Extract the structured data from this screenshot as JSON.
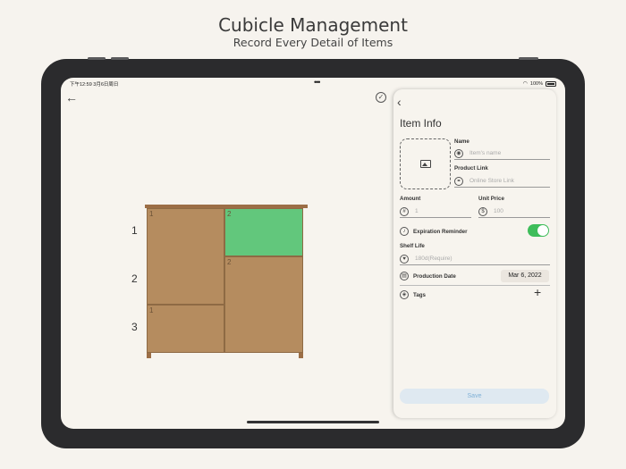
{
  "promo": {
    "title": "Cubicle Management",
    "subtitle": "Record Every Detail of Items"
  },
  "status_bar": {
    "time": "下午12:59  3月6日周日",
    "battery": "100%",
    "wifi_icon": "wifi-icon",
    "more_icon": "ellipsis-icon"
  },
  "toolbar": {
    "back_icon": "arrow-left-icon",
    "confirm_icon": "checkmark-circle-icon"
  },
  "cabinet": {
    "row_labels": [
      "1",
      "2",
      "3"
    ],
    "cells": [
      {
        "label": "1",
        "highlighted": false
      },
      {
        "label": "2",
        "highlighted": true
      },
      {
        "label": "2",
        "highlighted": false
      },
      {
        "label": "1",
        "highlighted": false
      }
    ],
    "colors": {
      "wood": "#b58c5f",
      "highlight": "#62c77c",
      "frame": "#9c6e46"
    }
  },
  "item_info": {
    "title": "Item Info",
    "image_icon": "photo-icon",
    "name": {
      "label": "Name",
      "placeholder": "Item's name",
      "icon": "tag-circle-icon"
    },
    "product_link": {
      "label": "Product Link",
      "placeholder": "Online Store Link",
      "icon": "link-circle-icon"
    },
    "amount": {
      "label": "Amount",
      "placeholder": "1",
      "icon": "number-circle-icon"
    },
    "unit_price": {
      "label": "Unit Price",
      "placeholder": "100",
      "icon": "dollar-circle-icon"
    },
    "expiration_reminder": {
      "label": "Expiration Reminder",
      "enabled": true,
      "icon": "bell-circle-icon"
    },
    "shelf_life": {
      "label": "Shelf Life",
      "placeholder": "180d(Require)",
      "icon": "heart-circle-icon"
    },
    "production_date": {
      "label": "Production Date",
      "value": "Mar 6, 2022",
      "icon": "calendar-circle-icon"
    },
    "tags": {
      "label": "Tags",
      "icon": "tag-icon",
      "add_icon": "plus-icon"
    },
    "save_label": "Save",
    "accent": "#3ebd5a"
  }
}
